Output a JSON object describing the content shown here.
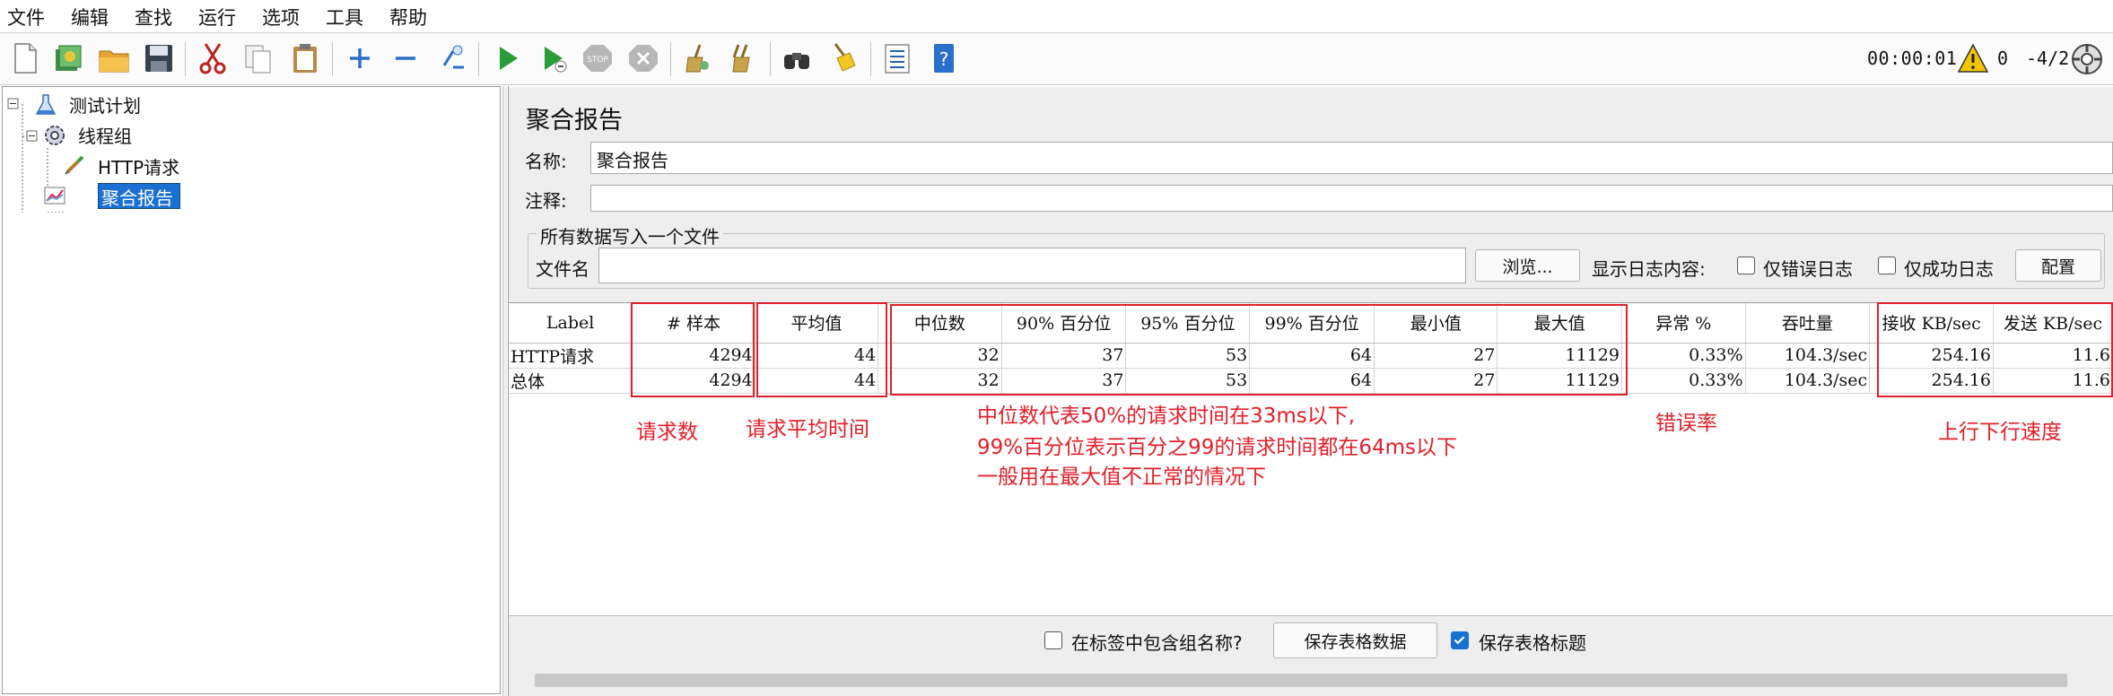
{
  "menu": [
    "文件",
    "编辑",
    "查找",
    "运行",
    "选项",
    "工具",
    "帮助"
  ],
  "toolbar": {
    "icons": [
      "new-icon",
      "templates-icon",
      "open-icon",
      "save-icon",
      "cut-icon",
      "copy-icon",
      "paste-icon",
      "expand-icon",
      "collapse-icon",
      "toggle-icon",
      "start-icon",
      "start-no-pause-icon",
      "stop-icon",
      "shutdown-icon",
      "clear-icon",
      "clear-all-icon",
      "search-icon",
      "reset-search-icon",
      "function-helper-icon",
      "help-icon"
    ],
    "timer": "00:00:01",
    "warning_count": "0",
    "threads": "-4/2"
  },
  "tree": {
    "test_plan": "测试计划",
    "thread_group": "线程组",
    "http_request": "HTTP请求",
    "aggregate_report": "聚合报告"
  },
  "panel": {
    "title": "聚合报告",
    "name_label": "名称:",
    "name_value": "聚合报告",
    "comment_label": "注释:",
    "comment_value": "",
    "fieldset_title": "所有数据写入一个文件",
    "filename_label": "文件名",
    "filename_value": "",
    "browse_button": "浏览...",
    "log_label": "显示日志内容:",
    "errors_only": "仅错误日志",
    "success_only": "仅成功日志",
    "configure_button": "配置"
  },
  "table": {
    "headers": [
      "Label",
      "# 样本",
      "平均值",
      "中位数",
      "90% 百分位",
      "95% 百分位",
      "99% 百分位",
      "最小值",
      "最大值",
      "异常 %",
      "吞吐量",
      "接收 KB/sec",
      "发送 KB/sec"
    ],
    "rows": [
      [
        "HTTP请求",
        "4294",
        "44",
        "32",
        "37",
        "53",
        "64",
        "27",
        "11129",
        "0.33%",
        "104.3/sec",
        "254.16",
        "11.6"
      ],
      [
        "总体",
        "4294",
        "44",
        "32",
        "37",
        "53",
        "64",
        "27",
        "11129",
        "0.33%",
        "104.3/sec",
        "254.16",
        "11.6"
      ]
    ]
  },
  "bottom": {
    "include_group_label": "在标签中包含组名称?",
    "include_group_checked": false,
    "save_table_button": "保存表格数据",
    "save_header_label": "保存表格标题",
    "save_header_checked": true
  },
  "annotations": {
    "samples": "请求数",
    "average": "请求平均时间",
    "percentiles": "中位数代表50%的请求时间在33ms以下,",
    "percentiles_line2": "99%百分位表示百分之99的请求时间都在64ms以下",
    "percentiles_line3": "一般用在最大值不正常的情况下",
    "error_rate": "错误率",
    "throughput": "上行下行速度"
  },
  "colors": {
    "annotation_red": "#e0202a",
    "selection_blue": "#1a6fd2",
    "panel_gray": "#eeeeee"
  }
}
